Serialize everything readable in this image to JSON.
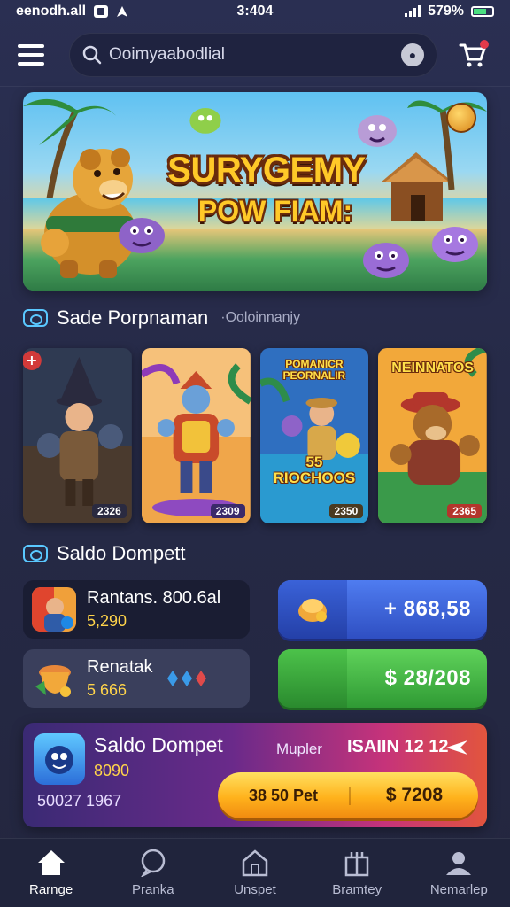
{
  "status_bar": {
    "carrier": "eenodh.all",
    "time": "3:404",
    "battery": "579%"
  },
  "header": {
    "search_value": "Ooimyaabodlial",
    "search_icon": "search-icon",
    "cart_icon": "cart-icon"
  },
  "banner": {
    "title": "SURYGEMY",
    "subtitle": "POW FIAM:"
  },
  "section_games": {
    "title": "Sade Porpnaman",
    "subtitle": "·Ooloinnanjy"
  },
  "cards": [
    {
      "title": "",
      "tag": "2326",
      "tag_color": "#2a2a40"
    },
    {
      "title": "",
      "tag": "2309",
      "tag_color": "#3a2a6a"
    },
    {
      "title": "POMANICR PEORNALIR",
      "bottom_title": "55 RIOCHOOS",
      "tag": "2350",
      "tag_color": "#4a3a20"
    },
    {
      "title": "NEINNATOS",
      "tag": "2365",
      "tag_color": "#b3362c"
    }
  ],
  "section_wallet": {
    "title": "Saldo Dompett"
  },
  "wallet_rows": [
    {
      "name": "Rantans. 800.6al",
      "amount": "5,290",
      "pill": "+ 868,58"
    },
    {
      "name": "Renatak",
      "amount": "5 666",
      "pill": "$ 28/208"
    }
  ],
  "promo": {
    "title": "Saldo Dompet",
    "amount": "8090",
    "bottom": "50027 1967",
    "label": "Mupler",
    "label2": "ISAIIN 12 12",
    "btn_left": "38 50 Pet",
    "btn_right": "$ 7208"
  },
  "nav": [
    {
      "label": "Rarnge",
      "icon": "home-icon"
    },
    {
      "label": "Pranka",
      "icon": "chat-icon"
    },
    {
      "label": "Unspet",
      "icon": "house-icon"
    },
    {
      "label": "Bramtey",
      "icon": "gift-icon"
    },
    {
      "label": "Nemarlep",
      "icon": "profile-icon"
    }
  ],
  "colors": {
    "background": "#262a47",
    "blue_pill": "#3a63d4",
    "green_pill": "#3fb24a",
    "gold": "#ffc928"
  }
}
